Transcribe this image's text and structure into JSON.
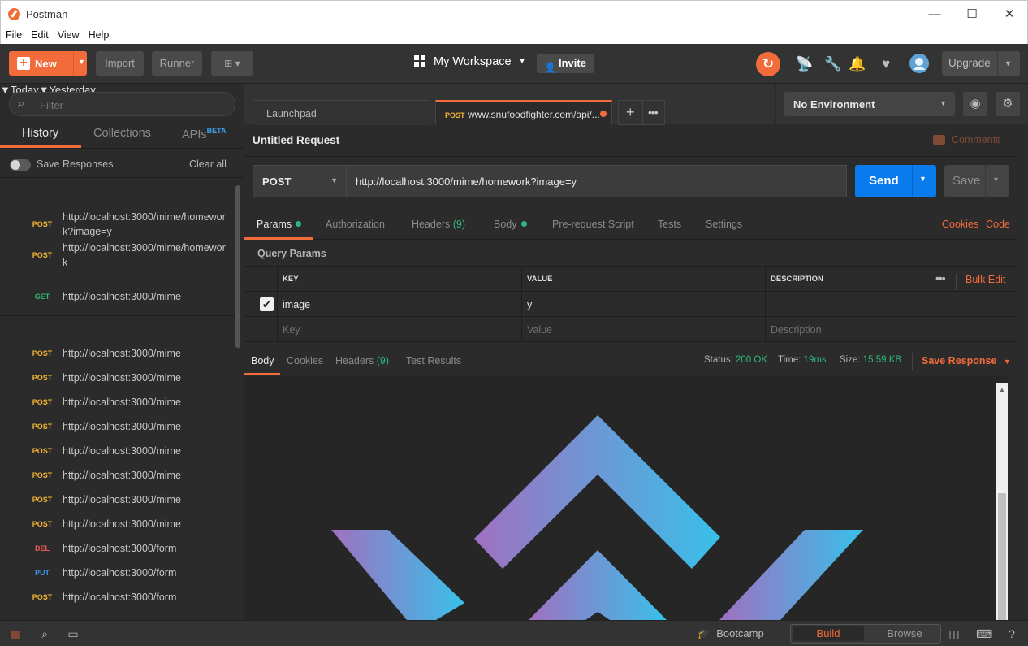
{
  "window": {
    "title": "Postman",
    "min": "—",
    "max": "☐",
    "close": "✕"
  },
  "menu": [
    "File",
    "Edit",
    "View",
    "Help"
  ],
  "header": {
    "new_label": "New",
    "import_label": "Import",
    "runner_label": "Runner",
    "workspace_label": "My Workspace",
    "invite_label": "Invite",
    "upgrade_label": "Upgrade"
  },
  "sidebar": {
    "filter_placeholder": "Filter",
    "tabs": {
      "history": "History",
      "collections": "Collections",
      "apis": "APIs",
      "apis_badge": "BETA"
    },
    "save_responses_label": "Save Responses",
    "clear_all_label": "Clear all",
    "groups": [
      {
        "title": "Today",
        "items": [
          {
            "method": "POST",
            "url": "http://localhost:3000/mime/homework?image=y"
          },
          {
            "method": "POST",
            "url": "http://localhost:3000/mime/homework"
          },
          {
            "method": "GET",
            "url": "http://localhost:3000/mime"
          }
        ]
      },
      {
        "title": "Yesterday",
        "items": [
          {
            "method": "POST",
            "url": "http://localhost:3000/mime"
          },
          {
            "method": "POST",
            "url": "http://localhost:3000/mime"
          },
          {
            "method": "POST",
            "url": "http://localhost:3000/mime"
          },
          {
            "method": "POST",
            "url": "http://localhost:3000/mime"
          },
          {
            "method": "POST",
            "url": "http://localhost:3000/mime"
          },
          {
            "method": "POST",
            "url": "http://localhost:3000/mime"
          },
          {
            "method": "POST",
            "url": "http://localhost:3000/mime"
          },
          {
            "method": "POST",
            "url": "http://localhost:3000/mime"
          },
          {
            "method": "DEL",
            "url": "http://localhost:3000/form"
          },
          {
            "method": "PUT",
            "url": "http://localhost:3000/form"
          },
          {
            "method": "POST",
            "url": "http://localhost:3000/form"
          }
        ]
      }
    ]
  },
  "request_tabs": {
    "launchpad": "Launchpad",
    "active_method": "POST",
    "active_title": "www.snufoodfighter.com/api/..."
  },
  "environment": {
    "selected": "No Environment"
  },
  "request": {
    "title": "Untitled Request",
    "comments_label": "Comments",
    "method": "POST",
    "url": "http://localhost:3000/mime/homework?image=y",
    "send_label": "Send",
    "save_label": "Save",
    "tabs": {
      "params": "Params",
      "authorization": "Authorization",
      "headers": "Headers",
      "headers_count": "(9)",
      "body": "Body",
      "prerequest": "Pre-request Script",
      "tests": "Tests",
      "settings": "Settings",
      "cookies": "Cookies",
      "code": "Code"
    },
    "query_params_label": "Query Params",
    "table": {
      "headers": {
        "key": "KEY",
        "value": "VALUE",
        "description": "DESCRIPTION",
        "bulk_edit": "Bulk Edit"
      },
      "rows": [
        {
          "key": "image",
          "value": "y",
          "description": ""
        }
      ],
      "placeholders": {
        "key": "Key",
        "value": "Value",
        "description": "Description"
      }
    }
  },
  "response": {
    "tabs": {
      "body": "Body",
      "cookies": "Cookies",
      "headers": "Headers",
      "headers_count": "(9)",
      "test_results": "Test Results"
    },
    "status_label": "Status:",
    "status_value": "200 OK",
    "time_label": "Time:",
    "time_value": "19ms",
    "size_label": "Size:",
    "size_value": "15.59 KB",
    "save_response_label": "Save Response"
  },
  "footer": {
    "bootcamp_label": "Bootcamp",
    "build_label": "Build",
    "browse_label": "Browse"
  },
  "colors": {
    "accent": "#f26b3a",
    "send": "#097bed",
    "post": "#f1b531",
    "get": "#2eb87a",
    "del": "#ef5b5b",
    "put": "#3a8fe8"
  }
}
